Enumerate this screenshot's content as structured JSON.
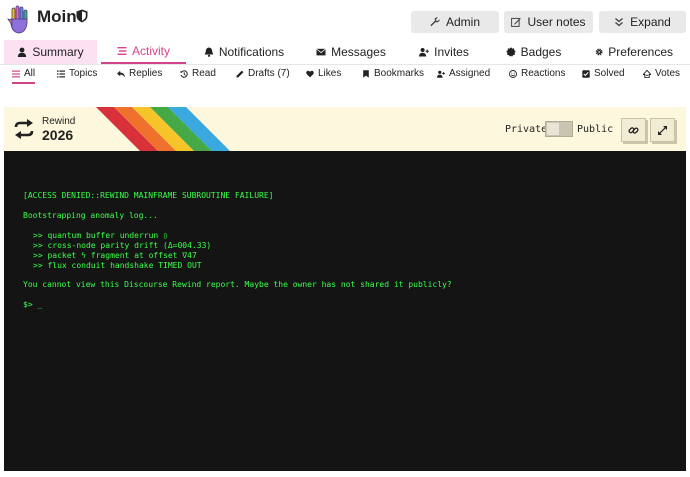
{
  "header": {
    "username": "Moin",
    "buttons": {
      "admin": "Admin",
      "user_notes": "User notes",
      "expand": "Expand"
    }
  },
  "primary_nav": [
    {
      "label": "Summary",
      "icon": "user-icon"
    },
    {
      "label": "Activity",
      "icon": "stream-icon",
      "active": true
    },
    {
      "label": "Notifications",
      "icon": "bell-icon"
    },
    {
      "label": "Messages",
      "icon": "envelope-icon"
    },
    {
      "label": "Invites",
      "icon": "user-plus-icon"
    },
    {
      "label": "Badges",
      "icon": "certificate-icon"
    },
    {
      "label": "Preferences",
      "icon": "gear-icon"
    }
  ],
  "secondary_nav": [
    {
      "label": "All",
      "icon": "list-icon",
      "active": true
    },
    {
      "label": "Topics",
      "icon": "list-ul-icon"
    },
    {
      "label": "Replies",
      "icon": "reply-icon"
    },
    {
      "label": "Read",
      "icon": "history-icon"
    },
    {
      "label": "Drafts (7)",
      "icon": "pencil-icon"
    },
    {
      "label": "Likes",
      "icon": "heart-icon"
    },
    {
      "label": "Bookmarks",
      "icon": "bookmark-icon"
    },
    {
      "label": "Assigned",
      "icon": "user-plus-icon"
    },
    {
      "label": "Reactions",
      "icon": "smile-icon"
    },
    {
      "label": "Solved",
      "icon": "check-square-icon"
    },
    {
      "label": "Votes",
      "icon": "votes-icon"
    }
  ],
  "rewind": {
    "label": "Rewind",
    "year": "2026",
    "private_label": "Private",
    "public_label": "Public",
    "is_public": false
  },
  "terminal": {
    "title": "[ACCESS DENIED::REWIND MAINFRAME SUBROUTINE FAILURE]",
    "boot": "Bootstrapping anomaly log...",
    "lines": [
      ">> quantum buffer underrun ▯",
      ">> cross-node parity drift (Δ=004.33)",
      ">> packet ϟ fragment at offset ∇47",
      ">> flux conduit handshake TIMED OUT"
    ],
    "message": "You cannot view this Discourse Rewind report. Maybe the owner has not shared it publicly?",
    "prompt": "$> _"
  },
  "colors": {
    "accent": "#d1448b",
    "summary_bg": "#fbe1f1",
    "banner_bg": "#fdf7de",
    "terminal_bg": "#141414",
    "terminal_text": "#3aff4a",
    "stripes": [
      "#d9313a",
      "#f0712e",
      "#f7c52a",
      "#45a948",
      "#3aa9e0"
    ]
  }
}
